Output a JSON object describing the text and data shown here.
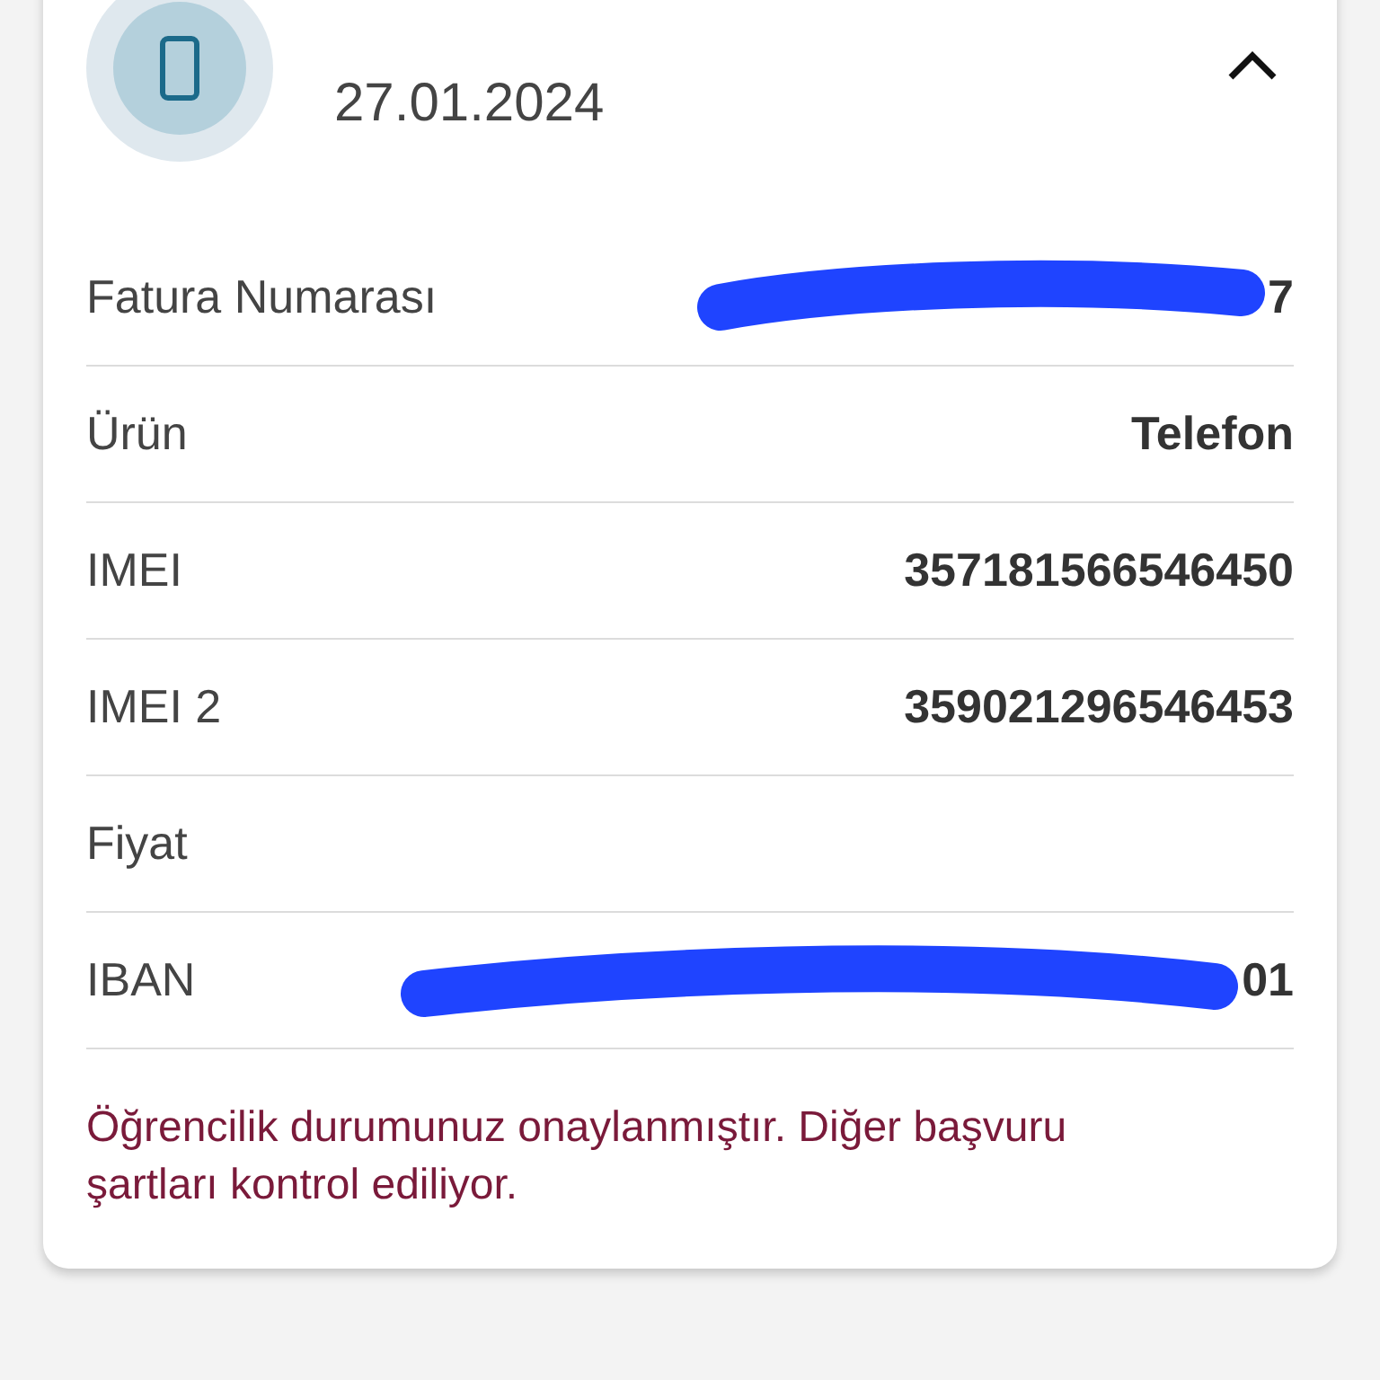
{
  "card": {
    "date": "27.01.2024",
    "expanded": true,
    "rows": [
      {
        "label": "Fatura Numarası",
        "value": "7",
        "redacted": true
      },
      {
        "label": "Ürün",
        "value": "Telefon",
        "redacted": false
      },
      {
        "label": "IMEI",
        "value": "357181566546450",
        "redacted": false
      },
      {
        "label": "IMEI 2",
        "value": "359021296546453",
        "redacted": false
      },
      {
        "label": "Fiyat",
        "redacted": false
      },
      {
        "label": "IBAN",
        "value": "01",
        "redacted": true
      }
    ],
    "message": "Öğrencilik durumunuz onaylanmıştır. Diğer başvuru şartları kontrol ediliyor."
  }
}
